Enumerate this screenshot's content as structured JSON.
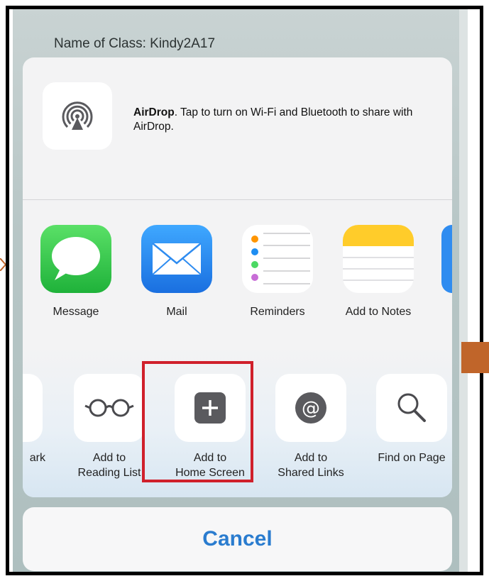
{
  "background": {
    "title": "Name of Class: Kindy2A17"
  },
  "airdrop": {
    "title": "AirDrop",
    "description": ". Tap to turn on Wi-Fi and Bluetooth to share with AirDrop.",
    "icon": "airdrop-icon"
  },
  "apps": [
    {
      "label": "Message",
      "icon": "messages-icon",
      "color": "#36c94a"
    },
    {
      "label": "Mail",
      "icon": "mail-icon",
      "color": "#2f8cf0"
    },
    {
      "label": "Reminders",
      "icon": "reminders-icon",
      "color": "#ffffff"
    },
    {
      "label": "Add to Notes",
      "icon": "notes-icon",
      "color": "#ffd12a"
    }
  ],
  "actions": [
    {
      "label_line1": "",
      "label_line2": "ark",
      "icon": "bookmark-icon"
    },
    {
      "label_line1": "Add to",
      "label_line2": "Reading List",
      "icon": "glasses-icon"
    },
    {
      "label_line1": "Add to",
      "label_line2": "Home Screen",
      "icon": "plus-icon"
    },
    {
      "label_line1": "Add to",
      "label_line2": "Shared Links",
      "icon": "at-icon"
    },
    {
      "label_line1": "Find on Page",
      "label_line2": "",
      "icon": "search-icon"
    }
  ],
  "cancel_label": "Cancel",
  "colors": {
    "highlight": "#d0202b",
    "accent": "#2a7ccf",
    "orange_marker": "#c0652a"
  }
}
